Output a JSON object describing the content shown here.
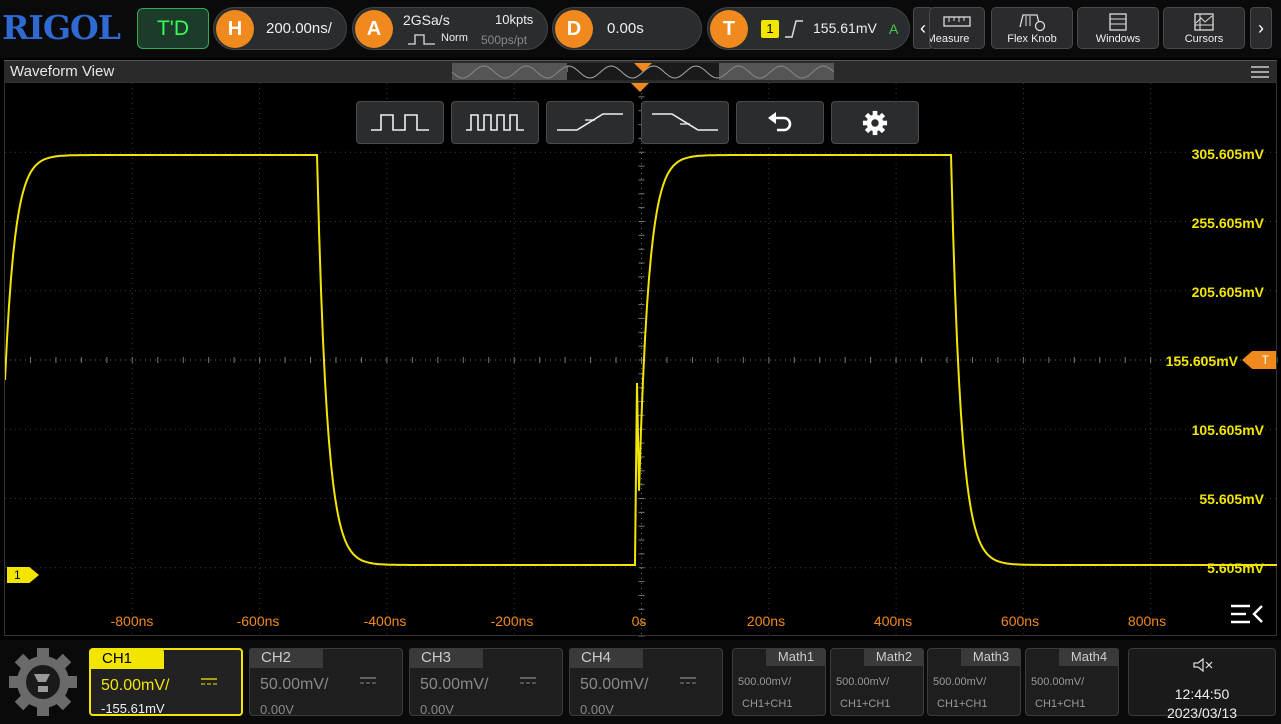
{
  "brand": "RIGOL",
  "top": {
    "run_state": "T'D",
    "horizontal": {
      "badge": "H",
      "scale": "200.00ns/"
    },
    "acquire": {
      "badge": "A",
      "sample_rate": "2GSa/s",
      "mode": "Norm",
      "memory": "10kpts",
      "resolution": "500ps/pt"
    },
    "delay": {
      "badge": "D",
      "value": "0.00s"
    },
    "trigger": {
      "badge": "T",
      "source": "1",
      "level": "155.61mV",
      "mode": "A"
    },
    "buttons": [
      {
        "label": "Measure",
        "icon": "measure-icon"
      },
      {
        "label": "Flex Knob",
        "icon": "flex-knob-icon"
      },
      {
        "label": "Windows",
        "icon": "windows-icon"
      },
      {
        "label": "Cursors",
        "icon": "cursors-icon"
      }
    ]
  },
  "waveform_view": {
    "title": "Waveform View",
    "volt_labels": [
      "305.605mV",
      "255.605mV",
      "205.605mV",
      "155.605mV",
      "105.605mV",
      "55.605mV",
      "5.605mV"
    ],
    "time_labels": [
      "-800ns",
      "-600ns",
      "-400ns",
      "-200ns",
      "0s",
      "200ns",
      "400ns",
      "600ns",
      "800ns"
    ],
    "trigger_marker": "T",
    "ch1_marker": "1"
  },
  "channels": [
    {
      "name": "CH1",
      "scale": "50.00mV/",
      "offset": "-155.61mV",
      "active": true
    },
    {
      "name": "CH2",
      "scale": "50.00mV/",
      "offset": "0.00V",
      "active": false
    },
    {
      "name": "CH3",
      "scale": "50.00mV/",
      "offset": "0.00V",
      "active": false
    },
    {
      "name": "CH4",
      "scale": "50.00mV/",
      "offset": "0.00V",
      "active": false
    }
  ],
  "math": [
    {
      "name": "Math1",
      "scale": "500.00mV/",
      "source": "CH1+CH1"
    },
    {
      "name": "Math2",
      "scale": "500.00mV/",
      "source": "CH1+CH1"
    },
    {
      "name": "Math3",
      "scale": "500.00mV/",
      "source": "CH1+CH1"
    },
    {
      "name": "Math4",
      "scale": "500.00mV/",
      "source": "CH1+CH1"
    }
  ],
  "clock": {
    "time": "12:44:50",
    "date": "2023/03/13"
  },
  "colors": {
    "ch1": "#f2e600",
    "accent": "#f08a1e",
    "brand": "#2e6ad1"
  }
}
